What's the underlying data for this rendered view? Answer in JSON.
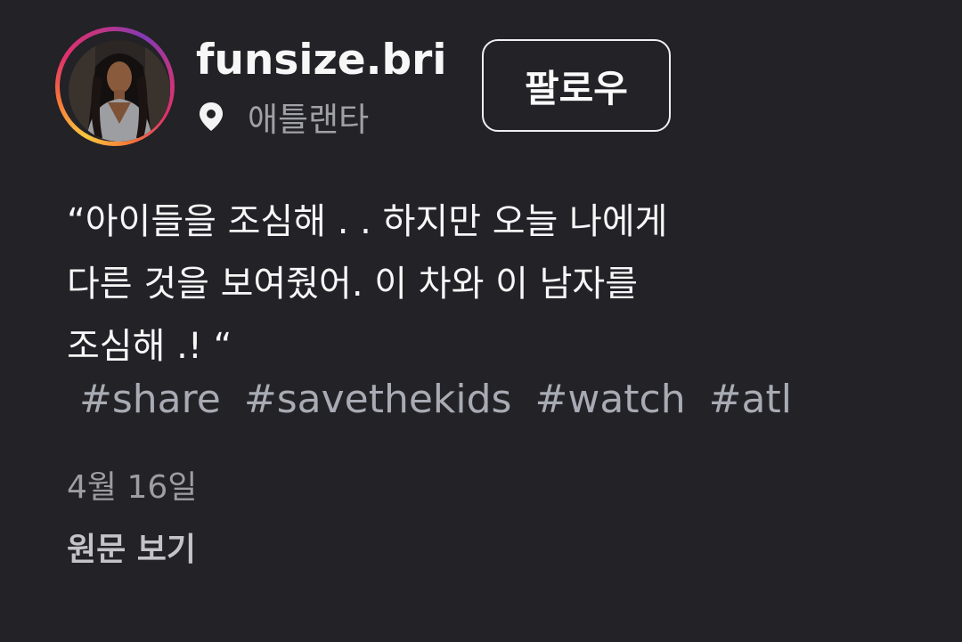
{
  "post": {
    "username": "funsize.bri",
    "location": "애틀랜타",
    "follow_label": "팔로우",
    "caption_lines": [
      "“아이들을 조심해 . . 하지만 오늘 나에게",
      "다른 것을 보여줬어. 이 차와 이 남자를",
      "조심해 .! “"
    ],
    "hashtags": [
      "#share",
      "#savethekids",
      "#watch",
      "#atl"
    ],
    "date": "4월 16일",
    "see_original_label": "원문 보기",
    "icons": {
      "location": "location-pin-icon",
      "avatar": "profile-avatar"
    }
  },
  "colors": {
    "background": "#222227",
    "text_primary": "#f7f7f7",
    "text_secondary": "#a0a0a7",
    "hashtag": "#a8abb3",
    "story_ring": [
      "#f9c940",
      "#f77737",
      "#e1306c",
      "#c13584",
      "#833ab4"
    ]
  }
}
